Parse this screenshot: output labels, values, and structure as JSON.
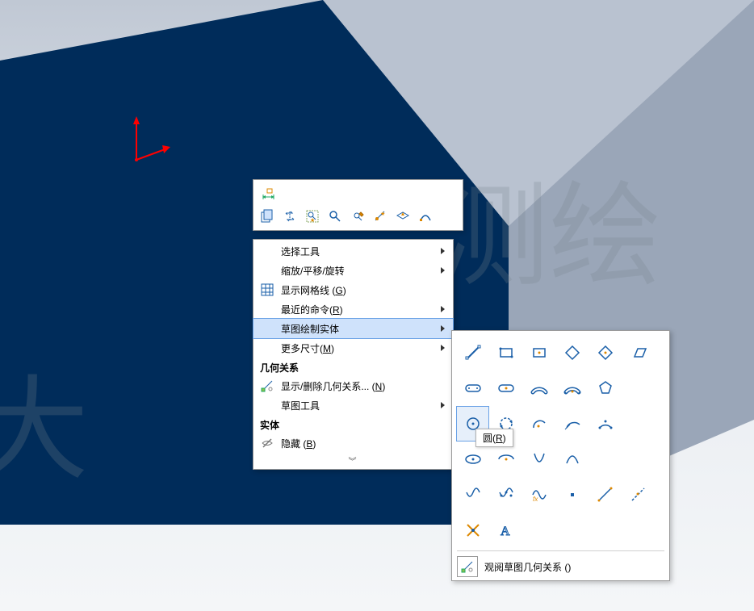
{
  "watermark": {
    "left": "大",
    "right": "测绘"
  },
  "ctx_toolbar": {
    "row1_icons": [
      "dimension-icon"
    ],
    "row2_icons": [
      "copy-icon",
      "swap-icon",
      "zoom-area-icon",
      "zoom-fit-icon",
      "measure-icon",
      "constraint-icon",
      "normal-icon",
      "sketch-icon"
    ]
  },
  "menu": {
    "items": [
      {
        "label": "选择工具",
        "icon": "",
        "has_sub": true
      },
      {
        "label": "缩放/平移/旋转",
        "icon": "",
        "has_sub": true
      },
      {
        "label_html": "显示网格线 (<u>G</u>)",
        "plain": "显示网格线 (G)",
        "icon": "grid-icon",
        "has_sub": false
      },
      {
        "label_html": "最近的命令(<u>R</u>)",
        "plain": "最近的命令(R)",
        "icon": "",
        "has_sub": true
      },
      {
        "label": "草图绘制实体",
        "icon": "",
        "has_sub": true,
        "highlight": true
      },
      {
        "label_html": "更多尺寸(<u>M</u>)",
        "plain": "更多尺寸(M)",
        "icon": "",
        "has_sub": true
      }
    ],
    "section_geom_header": "几何关系",
    "geom_items": [
      {
        "label_html": "显示/删除几何关系... (<u>N</u>)",
        "plain": "显示/删除几何关系... (N)",
        "icon": "relations-icon",
        "has_sub": false
      },
      {
        "label": "草图工具",
        "icon": "",
        "has_sub": true
      }
    ],
    "section_body_header": "实体",
    "body_items": [
      {
        "label_html": "隐藏 (<u>B</u>)",
        "plain": "隐藏 (B)",
        "icon": "hide-icon",
        "has_sub": false
      }
    ]
  },
  "flyout": {
    "rows": [
      [
        "line-icon",
        "rect-corner-icon",
        "rect-center-icon",
        "diamond-icon",
        "diamond-center-icon",
        "parallelogram-icon"
      ],
      [
        "slot-icon",
        "slot-center-icon",
        "slot-arc-icon",
        "slot-arc-center-icon",
        "polygon-icon",
        ""
      ],
      [
        "circle-icon",
        "circle-perimeter-icon",
        "arc-center-icon",
        "arc-tangent-icon",
        "arc-3pt-icon",
        ""
      ],
      [
        "ellipse-icon",
        "ellipse-partial-icon",
        "parabola-icon",
        "conic-icon",
        "",
        ""
      ],
      [
        "spline-icon",
        "spline-fit-icon",
        "equation-curve-icon",
        "point-icon",
        "centerline-icon",
        "midline-icon"
      ],
      [
        "text-bold-icon",
        "text-a-icon",
        "",
        "",
        "",
        ""
      ]
    ],
    "highlight": {
      "row": 2,
      "col": 0
    },
    "footer_icon": "relations-view-icon",
    "footer_label": "观阅草图几何关系 ()"
  },
  "tooltip": {
    "label_html": "圆(<u>R</u>)",
    "plain": "圆(R)"
  }
}
